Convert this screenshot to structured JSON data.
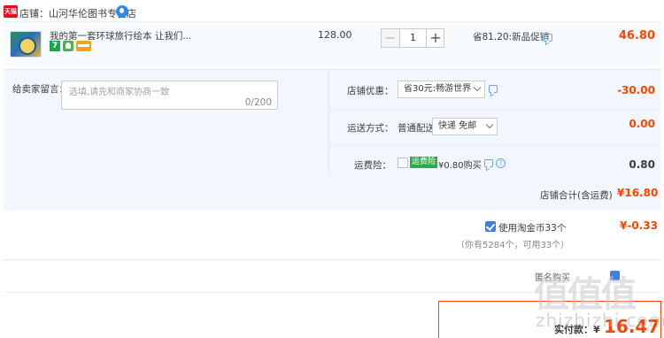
{
  "shop": {
    "badge": "天猫",
    "label": "店铺：山河华伦图书专营店"
  },
  "item": {
    "title": "我的第一套环球旅行绘本 让我们...",
    "badges": [
      "7",
      "wang-icon",
      "card-icon"
    ],
    "unit_price": "128.00",
    "quantity": "1",
    "minus": "−",
    "plus": "+",
    "promo": "省81.20:新品促销",
    "line_total": "46.80"
  },
  "message": {
    "label": "给卖家留言：",
    "placeholder": "选填,请先和商家协商一致",
    "counter": "0/200"
  },
  "shop_discount": {
    "label": "店铺优惠：",
    "selected": "省30元:畅游世界",
    "amount": "-30.00"
  },
  "shipping": {
    "label": "运送方式：",
    "method": "普通配送",
    "selected": "快递 免邮",
    "amount": "0.00"
  },
  "insurance": {
    "label": "运费险：",
    "badge": "运费险",
    "text": "¥0.80购买",
    "help": "?",
    "amount": "0.80"
  },
  "subtotal": {
    "label": "店铺合计(含运费)",
    "value": "¥16.80"
  },
  "taojinbi": {
    "label": "使用淘金币33个",
    "sub": "（你有5284个，可用33个）",
    "amount": "¥-0.33"
  },
  "hidden_row": {
    "text": "匿名购买"
  },
  "pay": {
    "label": "实付款：¥",
    "amount": "16.47"
  },
  "watermark": {
    "logo": "值|值|值",
    "url": "zhi zhi zhi.com"
  },
  "colors": {
    "accent": "#ff4400",
    "link": "#3d7ee3",
    "panel": "#f1f7fd",
    "green": "#2eaa4a"
  }
}
